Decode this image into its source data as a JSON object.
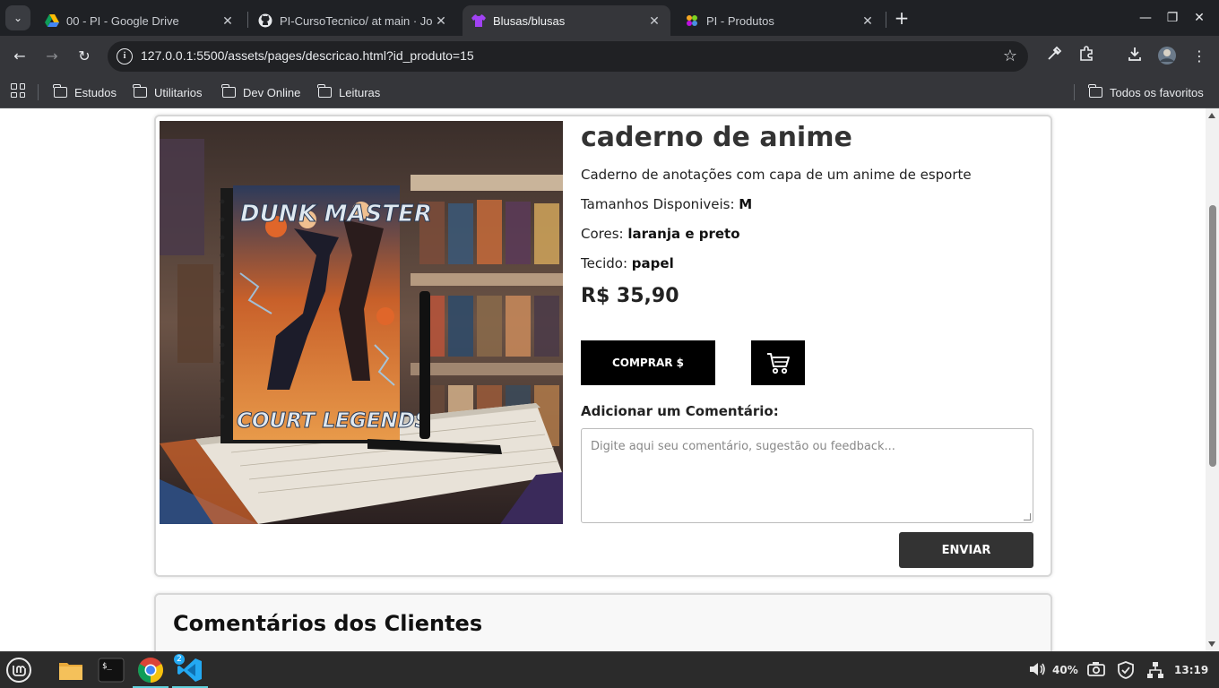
{
  "browser": {
    "tabs": [
      {
        "title": "00 - PI - Google Drive",
        "icon": "google-drive-icon"
      },
      {
        "title": "PI-CursoTecnico/ at main · Jo",
        "icon": "github-icon"
      },
      {
        "title": "Blusas/blusas",
        "icon": "shirt-icon",
        "active": true
      },
      {
        "title": "PI - Produtos",
        "icon": "app-icon"
      }
    ],
    "url": "127.0.0.1:5500/assets/pages/descricao.html?id_produto=15",
    "bookmarks": [
      "Estudos",
      "Utilitarios",
      "Dev Online",
      "Leituras"
    ],
    "all_bookmarks": "Todos os favoritos"
  },
  "product": {
    "name": "caderno de anime",
    "description": "Caderno de anotações com capa de um anime de esporte",
    "sizes_label": "Tamanhos Disponiveis:",
    "sizes_value": "M",
    "colors_label": "Cores:",
    "colors_value": "laranja e preto",
    "fabric_label": "Tecido:",
    "fabric_value": "papel",
    "price": "R$ 35,90",
    "buy_label": "COMPRAR $",
    "image_cover_top": "DUNK MASTER",
    "image_cover_bottom": "COURT LEGENDS"
  },
  "comment": {
    "label": "Adicionar um Comentário:",
    "placeholder": "Digite aqui seu comentário, sugestão ou feedback...",
    "send_label": "ENVIAR"
  },
  "reviews": {
    "title": "Comentários dos Clientes"
  },
  "taskbar": {
    "volume": "40%",
    "clock": "13:19",
    "vscode_badge": "2"
  },
  "colors": {
    "tabstrip": "#1f2125",
    "toolbar": "#35363a",
    "button_dark": "#000000",
    "send_button": "#333333"
  }
}
